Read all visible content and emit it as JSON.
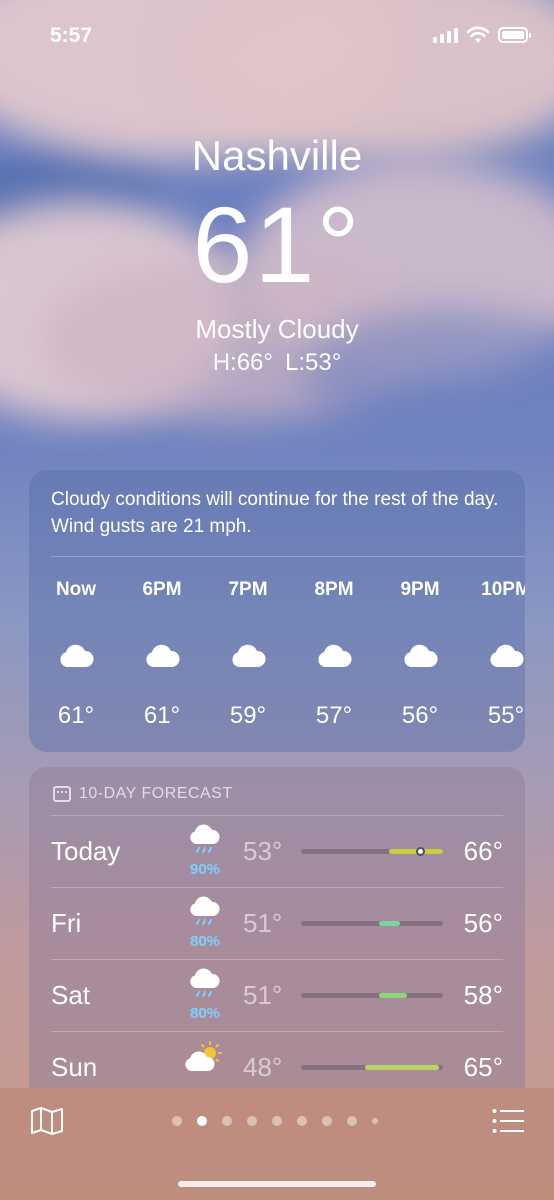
{
  "status_bar": {
    "time": "5:57"
  },
  "location": {
    "city": "Nashville",
    "temperature": "61°",
    "condition": "Mostly Cloudy",
    "high": "H:66°",
    "low": "L:53°"
  },
  "hourly": {
    "summary": "Cloudy conditions will continue for the rest of the day. Wind gusts are 21 mph.",
    "hours": [
      {
        "label": "Now",
        "icon": "cloud-icon",
        "temp": "61°"
      },
      {
        "label": "6PM",
        "icon": "cloud-icon",
        "temp": "61°"
      },
      {
        "label": "7PM",
        "icon": "cloud-icon",
        "temp": "59°"
      },
      {
        "label": "8PM",
        "icon": "cloud-icon",
        "temp": "57°"
      },
      {
        "label": "9PM",
        "icon": "cloud-icon",
        "temp": "56°"
      },
      {
        "label": "10PM",
        "icon": "cloud-icon",
        "temp": "55°"
      }
    ]
  },
  "forecast": {
    "title": "10-DAY FORECAST",
    "days": [
      {
        "day": "Today",
        "icon": "cloud-rain-icon",
        "precip": "90%",
        "low": "53°",
        "high": "66°",
        "range": [
          0.62,
          1.0
        ],
        "current": 0.84,
        "color": "#c9d03f"
      },
      {
        "day": "Fri",
        "icon": "cloud-rain-icon",
        "precip": "80%",
        "low": "51°",
        "high": "56°",
        "range": [
          0.55,
          0.7
        ],
        "color": "#7ed39a"
      },
      {
        "day": "Sat",
        "icon": "cloud-rain-icon",
        "precip": "80%",
        "low": "51°",
        "high": "58°",
        "range": [
          0.55,
          0.75
        ],
        "color": "#8fd57e"
      },
      {
        "day": "Sun",
        "icon": "partly-sunny-icon",
        "precip": "",
        "low": "48°",
        "high": "65°",
        "range": [
          0.45,
          0.97
        ],
        "color": "#b7d667"
      }
    ]
  },
  "pages": {
    "count": 9,
    "active": 1
  }
}
